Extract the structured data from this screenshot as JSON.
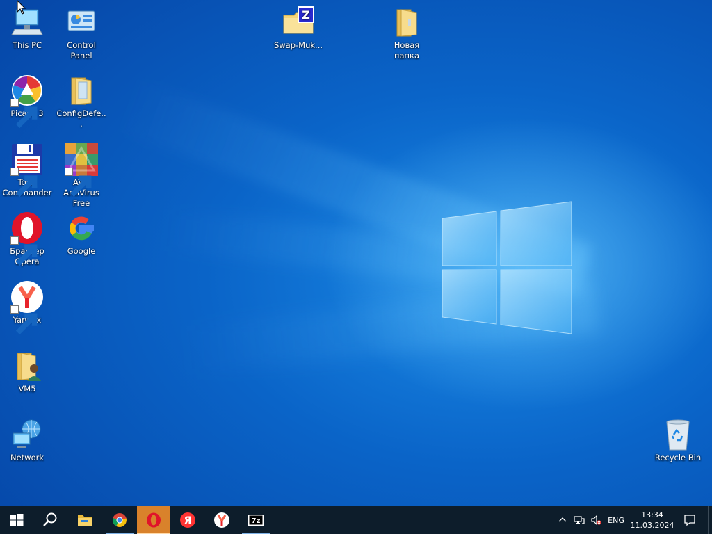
{
  "desktop": {
    "icons": [
      {
        "label": "This PC"
      },
      {
        "label": "Control Panel"
      },
      {
        "label": "Swap-Muk..."
      },
      {
        "label": "Новая папка"
      },
      {
        "label": "Picasa 3"
      },
      {
        "label": "ConfigDefe..."
      },
      {
        "label": "Total Commander"
      },
      {
        "label": "AVG AntiVirus Free"
      },
      {
        "label": "Браузер Opera"
      },
      {
        "label": "Google"
      },
      {
        "label": "Yandex"
      },
      {
        "label": "VM5"
      },
      {
        "label": "Network"
      },
      {
        "label": "Recycle Bin"
      }
    ]
  },
  "taskbar": {
    "buttons": [
      {
        "icon": "windows-start-icon"
      },
      {
        "icon": "search-icon"
      },
      {
        "icon": "file-explorer-icon"
      },
      {
        "icon": "chrome-icon"
      },
      {
        "icon": "opera-icon"
      },
      {
        "icon": "yandex-browser-icon"
      },
      {
        "icon": "yandex-icon"
      },
      {
        "icon": "7zip-icon",
        "text": "7z"
      }
    ],
    "tray": {
      "language": "ENG",
      "time": "13:34",
      "date": "11.03.2024"
    }
  },
  "colors": {
    "desktop_blue": "#0a64c8",
    "taskbar": "#0d1d2b",
    "active_app": "#d9822b"
  }
}
